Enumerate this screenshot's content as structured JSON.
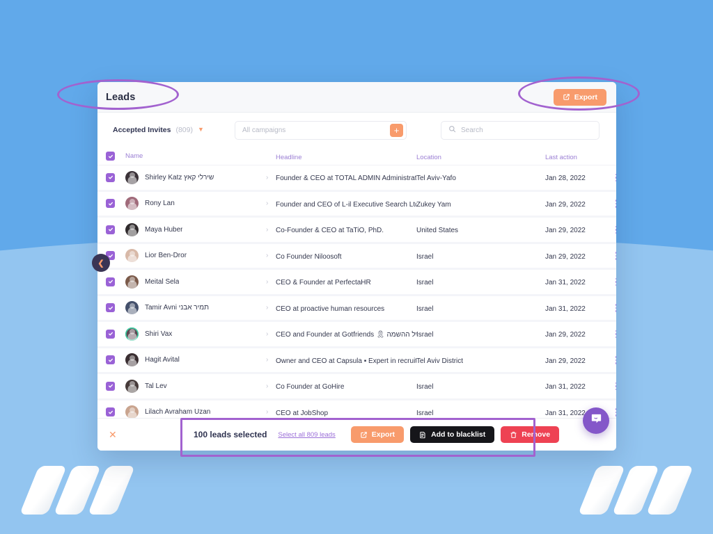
{
  "window": {
    "title": "Leads",
    "export_button": {
      "label": "Export",
      "icon": "external-link-icon",
      "color": "#f89b6c"
    }
  },
  "filters": {
    "invites_label": "Accepted Invites",
    "invites_count": "(809)",
    "caret_icon": "chevron-down-icon",
    "campaign_placeholder": "All campaigns",
    "add_campaign_icon": "plus-icon",
    "search_icon": "search-icon",
    "search_placeholder": "Search"
  },
  "table": {
    "columns": [
      "Name",
      "Headline",
      "Location",
      "Last action"
    ],
    "select_all_checked": true,
    "rows": [
      {
        "name": "Shirley Katz שירלי קאץ",
        "headline": "Founder & CEO at TOTAL ADMIN Administration…",
        "location": "Tel Aviv-Yafo",
        "last_action": "Jan 28, 2022",
        "checked": true,
        "avatar_color": "#3b3238",
        "avatar_ring": false
      },
      {
        "name": "Rony Lan",
        "headline": "Founder and CEO of L-il Executive Search Ltd.",
        "location": "Zukey Yam",
        "last_action": "Jan 29, 2022",
        "checked": true,
        "avatar_color": "#a06a7a",
        "avatar_ring": false
      },
      {
        "name": "Maya Huber",
        "headline": "Co-Founder & CEO at TaTiO, PhD.",
        "location": "United States",
        "last_action": "Jan 29, 2022",
        "checked": true,
        "avatar_color": "#2f2a2c",
        "avatar_ring": false
      },
      {
        "name": "Lior Ben-Dror",
        "headline": "Co Founder Niloosoft",
        "location": "Israel",
        "last_action": "Jan 29, 2022",
        "checked": true,
        "avatar_color": "#d8b9a8",
        "avatar_ring": false
      },
      {
        "name": "Meital Sela",
        "headline": "CEO & Founder at PerfectaHR",
        "location": "Israel",
        "last_action": "Jan 31, 2022",
        "checked": true,
        "avatar_color": "#7b5a4a",
        "avatar_ring": false
      },
      {
        "name": "Tamir Avni תמיר אבני",
        "headline": "CEO at proactive human resources",
        "location": "Israel",
        "last_action": "Jan 31, 2022",
        "checked": true,
        "avatar_color": "#44506b",
        "avatar_ring": false
      },
      {
        "name": "Shiri Vax",
        "headline": "CEO and Founder at Gotfriends 🎗 של ההשמה …",
        "location": "Israel",
        "last_action": "Jan 29, 2022",
        "checked": true,
        "avatar_color": "#5d4a52",
        "avatar_ring": true
      },
      {
        "name": "Hagit Avital",
        "headline": "Owner and CEO at Capsula ▪ Expert in recruiti…",
        "location": "Tel Aviv District",
        "last_action": "Jan 29, 2022",
        "checked": true,
        "avatar_color": "#3a2e31",
        "avatar_ring": false
      },
      {
        "name": "Tal Lev",
        "headline": "Co Founder at GoHire",
        "location": "Israel",
        "last_action": "Jan 31, 2022",
        "checked": true,
        "avatar_color": "#463a39",
        "avatar_ring": false
      },
      {
        "name": "Lilach Avraham Uzan",
        "headline": "CEO at JobShop",
        "location": "Israel",
        "last_action": "Jan 31, 2022",
        "checked": true,
        "avatar_color": "#c9a48f",
        "avatar_ring": false
      }
    ],
    "row_menu_icon": "kebab-menu-icon",
    "row_expand_icon": "chevron-right-icon"
  },
  "action_bar": {
    "close_icon": "close-icon",
    "selected_text": "100 leads selected",
    "select_all_link": "Select all 809 leads",
    "buttons": [
      {
        "label": "Export",
        "icon": "external-link-icon",
        "color": "#f89b6c"
      },
      {
        "label": "Add to blacklist",
        "icon": "blacklist-icon",
        "color": "#16161a"
      },
      {
        "label": "Remove",
        "icon": "trash-icon",
        "color": "#ee4253"
      }
    ]
  },
  "chat_launcher": {
    "icon": "chat-bubble-icon",
    "color": "#8457c9"
  },
  "collapse_handle": {
    "icon": "chevron-left-icon"
  },
  "annotations": {
    "color": "#a262cf"
  }
}
